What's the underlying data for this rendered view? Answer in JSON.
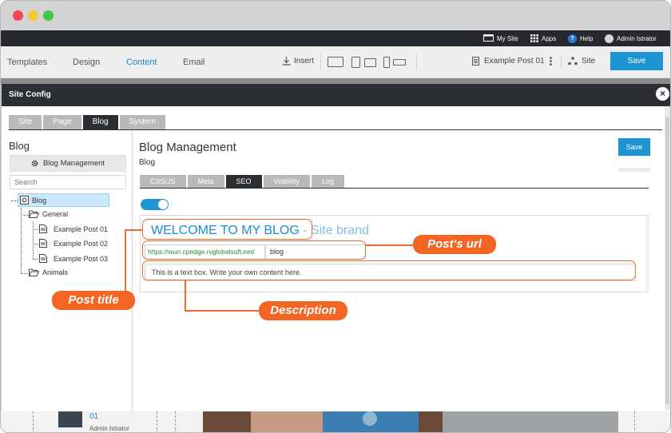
{
  "topbar": {
    "my_site": "My Site",
    "apps": "Apps",
    "help": "Help",
    "help_glyph": "?",
    "user": "Admin Istrator"
  },
  "toolbar": {
    "tabs": [
      "Templates",
      "Design",
      "Content",
      "Email"
    ],
    "active_tab": "Content",
    "insert": "Insert",
    "post": "Example Post 01",
    "site": "Site",
    "save": "Save"
  },
  "modal": {
    "title": "Site Config",
    "tabs": [
      "Site",
      "Page",
      "Blog",
      "System"
    ],
    "active_tab": "Blog",
    "left": {
      "title": "Blog",
      "manage_button": "Blog Management",
      "search_placeholder": "Search",
      "tree": {
        "root": "Blog",
        "category1": "General",
        "posts": [
          "Example Post 01",
          "Example Post 02",
          "Example Post 03"
        ],
        "category2": "Animals"
      }
    },
    "right": {
      "title": "Blog Management",
      "subtitle": "Blog",
      "save": "Save",
      "subtabs": [
        "CSS/JS",
        "Meta",
        "SEO",
        "Visibility",
        "Log"
      ],
      "active_subtab": "SEO",
      "toggle_on": true,
      "preview": {
        "heading": "WELCOME TO MY BLOG",
        "brand": " - Site brand",
        "url_prefix": "https://wun.cpedge.rvglobalsoft.net/",
        "slug": "blog",
        "description": "This is a text box. Write your own content here."
      }
    }
  },
  "annotations": {
    "post_title": "Post title",
    "post_url": "Post's url",
    "description": "Description"
  },
  "bottom": {
    "number": "01",
    "author": "Admin Istrator"
  },
  "colors": {
    "accent": "#1e95d3",
    "callout": "#f26522",
    "dark": "#2b2e33"
  }
}
